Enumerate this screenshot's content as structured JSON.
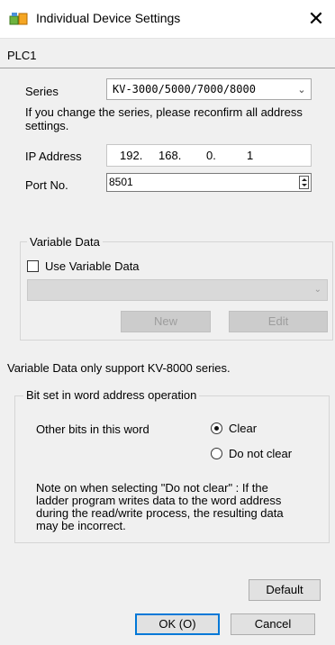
{
  "window": {
    "title": "Individual Device Settings",
    "close_glyph": "✕"
  },
  "plc_label": "PLC1",
  "series": {
    "label": "Series",
    "value": "KV-3000/5000/7000/8000",
    "note": "If you change the series, please reconfirm all address settings."
  },
  "ip": {
    "label": "IP Address",
    "octets": [
      "192.",
      "168.",
      "0.",
      "1"
    ]
  },
  "port": {
    "label": "Port No.",
    "value": "8501"
  },
  "variable_data": {
    "legend": "Variable Data",
    "use_label": "Use Variable Data",
    "use_checked": false,
    "select_value": "",
    "new_label": "New",
    "edit_label": "Edit"
  },
  "variable_note": "Variable Data only support KV-8000 series.",
  "bit_set": {
    "legend": "Bit set in word address operation",
    "other_bits_label": "Other bits in this word",
    "options": [
      "Clear",
      "Do not clear"
    ],
    "selected": "Clear",
    "note": "Note on when selecting \"Do not clear\" : If the ladder program writes data to the word address during the read/write process, the resulting data may be incorrect."
  },
  "buttons": {
    "default": "Default",
    "ok": "OK (O)",
    "cancel": "Cancel"
  },
  "icons": {
    "app": "device-settings-icon",
    "close": "close-icon",
    "dropdown": "chevron-down-icon",
    "spin": "spin-button-icon"
  }
}
